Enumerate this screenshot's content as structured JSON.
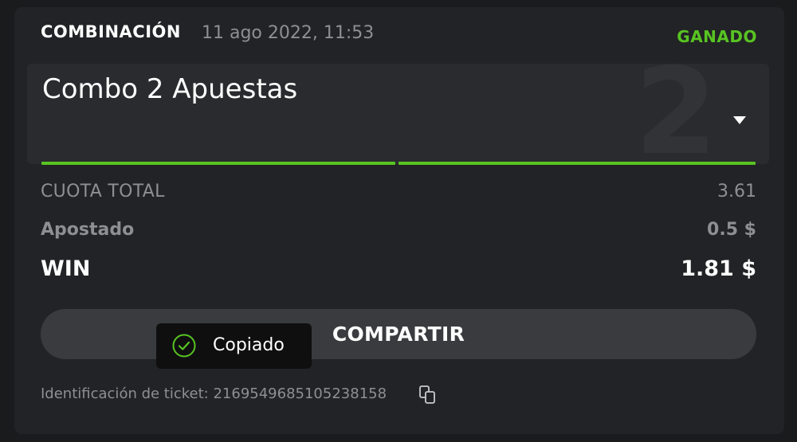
{
  "header": {
    "bet_type": "COMBINACIÓN",
    "date": "11 ago 2022, 11:53",
    "status": "GANADO"
  },
  "bet": {
    "title": "Combo 2 Apuestas",
    "count": "2",
    "progress_segments": [
      "won",
      "won"
    ]
  },
  "summary": {
    "total_odds_label": "CUOTA TOTAL",
    "total_odds_value": "3.61",
    "staked_label": "Apostado",
    "staked_value": "0.5 $",
    "win_label": "WIN",
    "win_value": "1.81 $"
  },
  "actions": {
    "share_label": "COMPARTIR"
  },
  "toast": {
    "text": "Copiado",
    "icon": "check-circle-icon"
  },
  "ticket": {
    "id_text": "Identificación de ticket: 2169549685105238158",
    "copy_icon": "copy-icon"
  },
  "colors": {
    "status_green": "#58c422",
    "background": "#1a1b1d",
    "card": "#222326",
    "muted_text": "#8e8f93"
  }
}
